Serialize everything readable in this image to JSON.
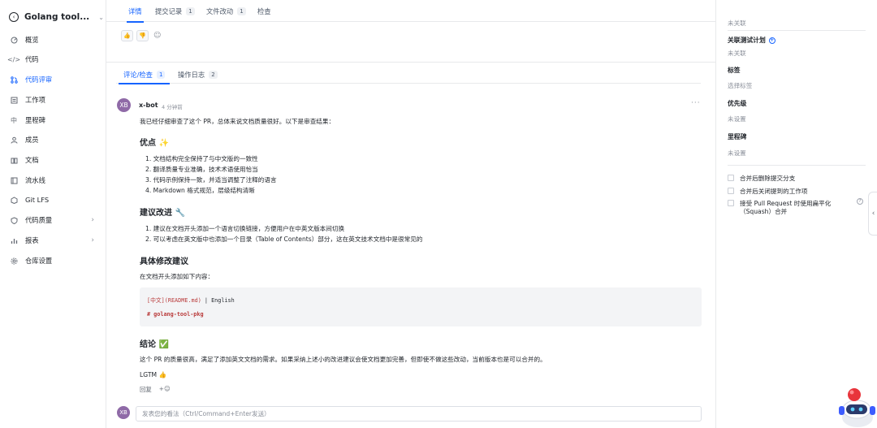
{
  "project": {
    "name": "Golang tool..."
  },
  "sidebar": {
    "items": [
      {
        "label": "概览",
        "icon": "grid-icon"
      },
      {
        "label": "代码",
        "icon": "code-icon"
      },
      {
        "label": "代码评审",
        "icon": "merge-request-icon",
        "active": true
      },
      {
        "label": "工作项",
        "icon": "list-icon"
      },
      {
        "label": "里程碑",
        "icon": "milestone-icon"
      },
      {
        "label": "成员",
        "icon": "members-icon"
      },
      {
        "label": "文档",
        "icon": "book-icon"
      },
      {
        "label": "流水线",
        "icon": "pipeline-icon"
      },
      {
        "label": "Git LFS",
        "icon": "lfs-icon"
      },
      {
        "label": "代码质量",
        "icon": "quality-icon",
        "has_children": true
      },
      {
        "label": "报表",
        "icon": "chart-icon",
        "has_children": true
      },
      {
        "label": "仓库设置",
        "icon": "settings-icon"
      }
    ]
  },
  "top_tabs": [
    {
      "label": "详情",
      "active": true
    },
    {
      "label": "提交记录",
      "count": "1"
    },
    {
      "label": "文件改动",
      "count": "1"
    },
    {
      "label": "检查"
    }
  ],
  "sub_tabs": [
    {
      "label": "评论/检查",
      "count": "1",
      "active": true
    },
    {
      "label": "操作日志",
      "count": "2"
    }
  ],
  "comment": {
    "avatar": "XB",
    "author": "x-bot",
    "time": "4 分钟前",
    "intro": "我已经仔细审查了这个 PR，总体来说文档质量很好。以下是审查结果：",
    "section1_title": "优点 ✨",
    "section1_items": [
      "1. 文档结构完全保持了与中文版的一致性",
      "2. 翻译质量专业准确，技术术语使用恰当",
      "3. 代码示例保持一致，并适当调整了注释的语言",
      "4. Markdown 格式规范，层级结构清晰"
    ],
    "section2_title": "建议改进 🔧",
    "section2_items": [
      "1. 建议在文档开头添加一个语言切换链接，方便用户在中英文版本间切换",
      "2. 可以考虑在英文版中也添加一个目录（Table of Contents）部分，这在英文技术文档中是很常见的"
    ],
    "section3_title": "具体修改建议",
    "section3_text": "在文档开头添加如下内容：",
    "code_line1_a": "[中文]",
    "code_line1_b": "(README.md)",
    "code_line1_c": " | English",
    "code_line2": "# golang-tool-pkg",
    "section4_title": "结论 ✅",
    "conclusion": "这个 PR 的质量很高，满足了添加英文文档的需求。如果采纳上述小的改进建议会使文档更加完善，但即使不做这些改动，当前版本也是可以合并的。",
    "lgtm": "LGTM 👍",
    "reply": "回复",
    "add_reaction": "+☺"
  },
  "composer": {
    "avatar": "XB",
    "placeholder": "发表您的看法（Ctrl/Command+Enter发送）"
  },
  "right_panel": {
    "top_value": "未关联",
    "test_plan_label": "关联测试计划",
    "test_plan_value": "未关联",
    "tags_label": "标签",
    "tags_value": "选择标签",
    "priority_label": "优先级",
    "priority_value": "未设置",
    "milestone_label": "里程碑",
    "milestone_value": "未设置",
    "options": [
      "合并后删除提交分支",
      "合并后关闭提到的工作项",
      "接受 Pull Request 时使用扁平化",
      "（Squash）合并"
    ]
  },
  "colors": {
    "accent": "#1664ff",
    "avatar": "#8f6aa7"
  }
}
